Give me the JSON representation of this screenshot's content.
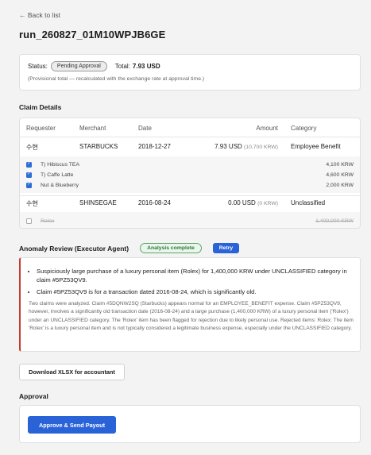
{
  "nav": {
    "back_label": "← Back to list"
  },
  "page": {
    "title": "run_260827_01M10WPJB6GE"
  },
  "status": {
    "label": "Status:",
    "badge": "Pending Approval",
    "total_label": "Total:",
    "total_value": "7.93 USD",
    "note": "(Provisional total — recalculated with the exchange rate at approval time.)"
  },
  "claims": {
    "section_title": "Claim Details",
    "columns": {
      "requester": "Requester",
      "merchant": "Merchant",
      "date": "Date",
      "amount": "Amount",
      "category": "Category"
    },
    "rows": [
      {
        "requester": "수현",
        "merchant": "STARBUCKS",
        "date": "2018-12-27",
        "amount": "7.93 USD",
        "amount_sub": "(10,700 KRW)",
        "category": "Employee Benefit",
        "items": [
          {
            "name": "T) Hibiscus TEA",
            "amount": "4,100 KRW",
            "checked": true
          },
          {
            "name": "T) Caffe Latte",
            "amount": "4,600 KRW",
            "checked": true
          },
          {
            "name": "Nut & Blueberry",
            "amount": "2,000 KRW",
            "checked": true
          }
        ]
      },
      {
        "requester": "수현",
        "merchant": "SHINSEGAE",
        "date": "2016-08-24",
        "amount": "0.00 USD",
        "amount_sub": "(0 KRW)",
        "category": "Unclassified",
        "items": [
          {
            "name": "Rolex",
            "amount": "1,400,000 KRW",
            "checked": false
          }
        ]
      }
    ]
  },
  "anomaly": {
    "section_title": "Anomaly Review (Executor Agent)",
    "badge": "Analysis complete",
    "retry_label": "Retry",
    "bullets": [
      "Suspiciously large purchase of a luxury personal item (Rolex) for 1,400,000 KRW under UNCLASSIFIED category in claim #5PZ53QV9.",
      "Claim #5PZ53QV9 is for a transaction dated 2016-08-24, which is significantly old."
    ],
    "summary": "Two claims were analyzed. Claim #5DQNW2SQ (Starbucks) appears normal for an EMPLOYEE_BENEFIT expense. Claim #5PZ53QV9, however, involves a significantly old transaction date (2016-08-24) and a large purchase (1,400,000 KRW) of a luxury personal item ('Rolex') under an UNCLASSIFIED category. The 'Rolex' item has been flagged for rejection due to likely personal use. Rejected items: Rolex: The item 'Rolex' is a luxury personal item and is not typically considered a legitimate business expense, especially under the UNCLASSIFIED category."
  },
  "actions": {
    "download_label": "Download XLSX for accountant"
  },
  "approval": {
    "section_title": "Approval",
    "approve_label": "Approve & Send Payout"
  }
}
